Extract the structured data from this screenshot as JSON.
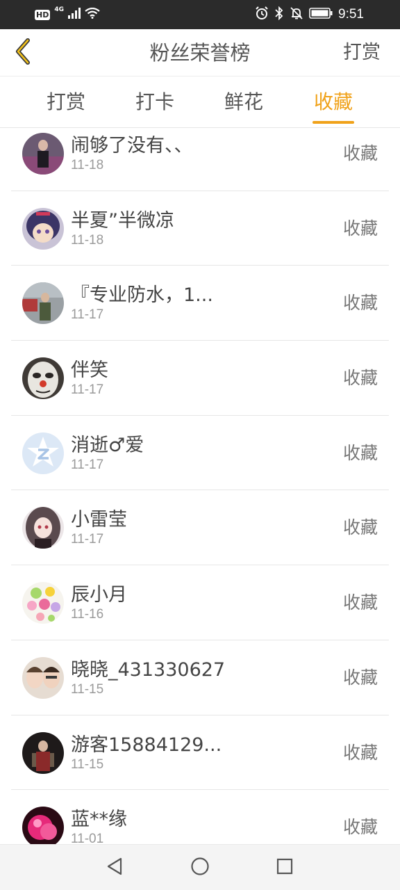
{
  "status_bar": {
    "hd": "HD",
    "network": "4G",
    "time": "9:51",
    "icons": [
      "signal-icon",
      "wifi-icon",
      "alarm-icon",
      "bluetooth-icon",
      "mute-icon",
      "battery-icon"
    ]
  },
  "header": {
    "title": "粉丝荣誉榜",
    "action": "打赏",
    "back_icon": "chevron-left-icon",
    "accent": "#f0a21a"
  },
  "tabs": [
    {
      "label": "打赏",
      "active": false
    },
    {
      "label": "打卡",
      "active": false
    },
    {
      "label": "鲜花",
      "active": false
    },
    {
      "label": "收藏",
      "active": true
    }
  ],
  "list": [
    {
      "name": "闹够了没有、、",
      "date": "11-18",
      "action": "收藏"
    },
    {
      "name": "半夏”半微凉",
      "date": "11-18",
      "action": "收藏"
    },
    {
      "name": "『专业防水，1...",
      "date": "11-17",
      "action": "收藏"
    },
    {
      "name": "伴笑",
      "date": "11-17",
      "action": "收藏"
    },
    {
      "name": "消逝♂爱",
      "date": "11-17",
      "action": "收藏"
    },
    {
      "name": "小雷莹",
      "date": "11-17",
      "action": "收藏"
    },
    {
      "name": "辰小月",
      "date": "11-16",
      "action": "收藏"
    },
    {
      "name": "晓晓_431330627",
      "date": "11-15",
      "action": "收藏"
    },
    {
      "name": "游客15884129...",
      "date": "11-15",
      "action": "收藏"
    },
    {
      "name": "蓝**缘",
      "date": "11-01",
      "action": "收藏"
    }
  ],
  "nav_bar": {
    "icons": [
      "back-triangle-icon",
      "home-circle-icon",
      "recents-square-icon"
    ]
  }
}
